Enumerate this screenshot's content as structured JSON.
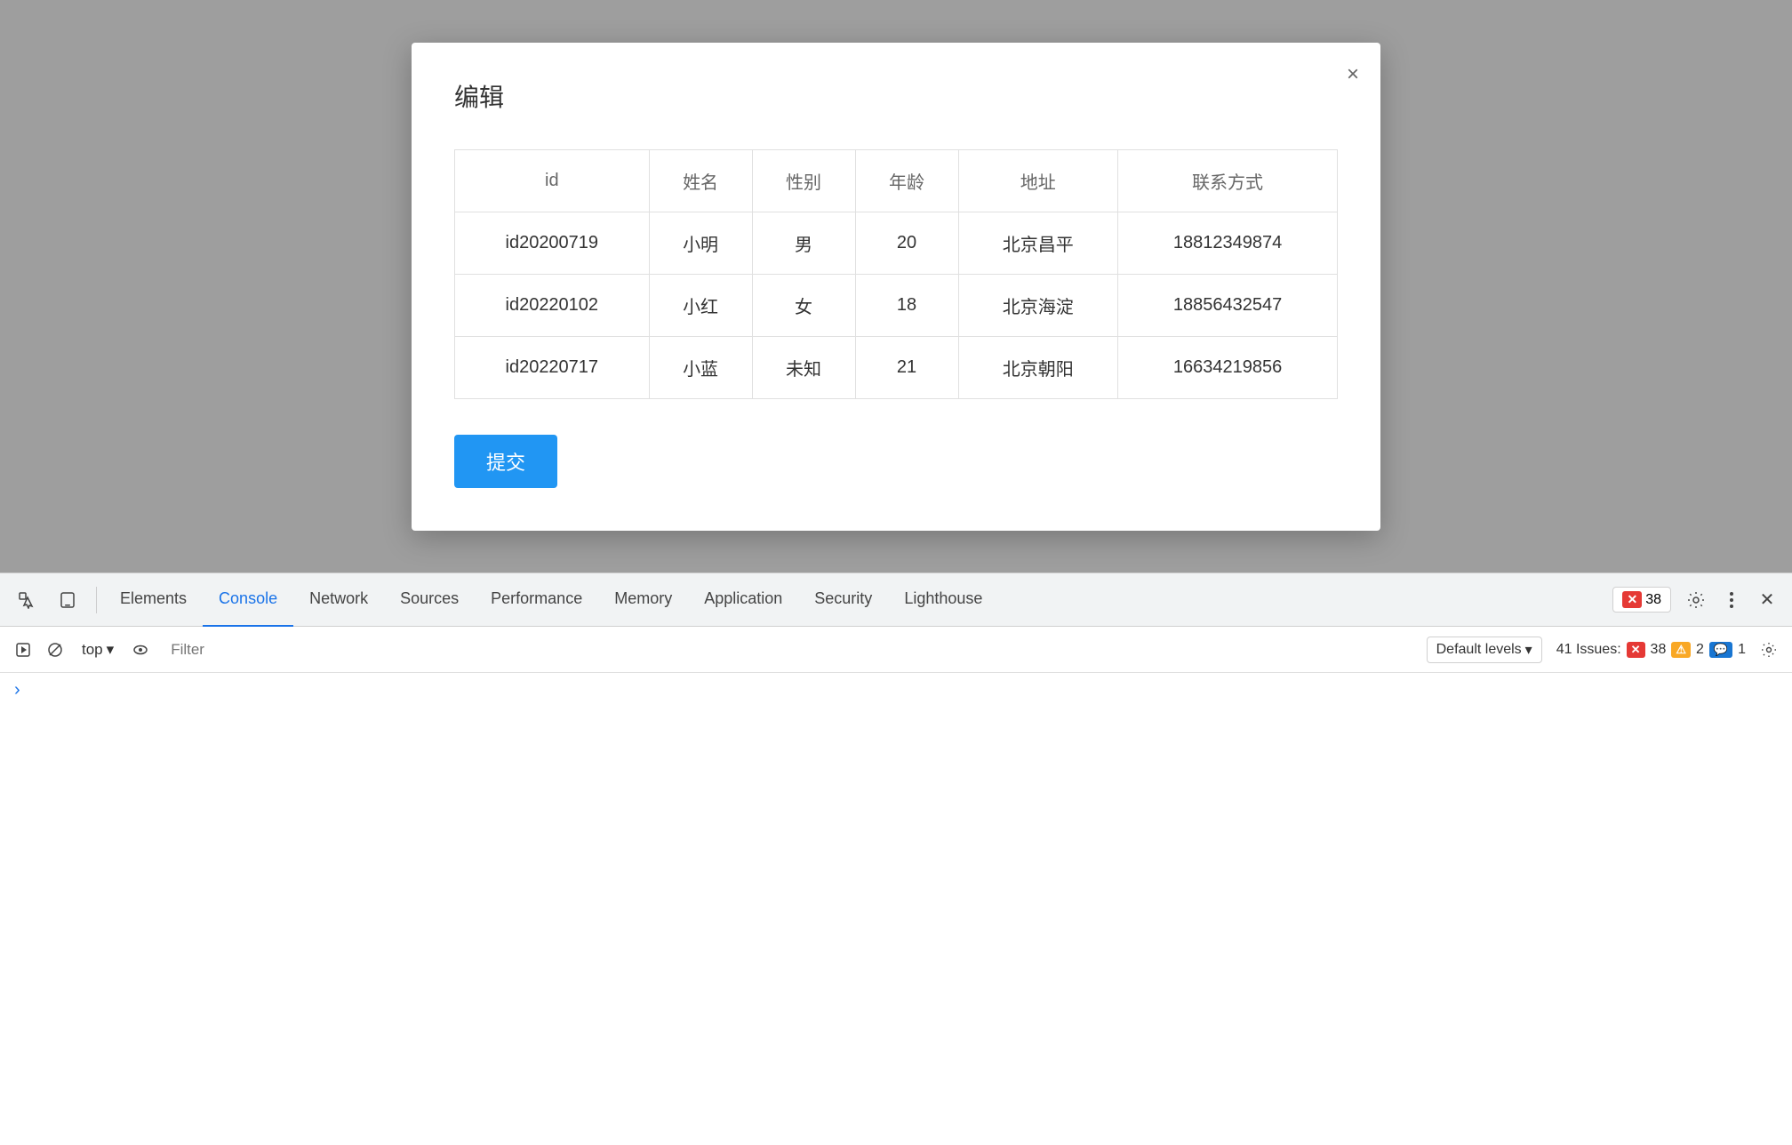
{
  "modal": {
    "title": "编辑",
    "close_label": "×",
    "submit_label": "提交",
    "table": {
      "headers": [
        "id",
        "姓名",
        "性别",
        "年龄",
        "地址",
        "联系方式"
      ],
      "rows": [
        {
          "id": "id20200719",
          "name": "小明",
          "gender": "男",
          "gender_color": "normal",
          "age": "20",
          "age_color": "normal",
          "address": "北京昌平",
          "contact": "18812349874",
          "contact_color": "red"
        },
        {
          "id": "id20220102",
          "name": "小红",
          "gender": "女",
          "gender_color": "red",
          "age": "18",
          "age_color": "normal",
          "address": "北京海淀",
          "contact": "18856432547",
          "contact_color": "normal"
        },
        {
          "id": "id20220717",
          "name": "小蓝",
          "gender": "未知",
          "gender_color": "normal",
          "age": "21",
          "age_color": "red",
          "address": "北京朝阳",
          "contact": "16634219856",
          "contact_color": "normal"
        }
      ]
    }
  },
  "devtools": {
    "tabs": [
      {
        "label": "Elements",
        "active": false
      },
      {
        "label": "Console",
        "active": true
      },
      {
        "label": "Network",
        "active": false
      },
      {
        "label": "Sources",
        "active": false
      },
      {
        "label": "Performance",
        "active": false
      },
      {
        "label": "Memory",
        "active": false
      },
      {
        "label": "Application",
        "active": false
      },
      {
        "label": "Security",
        "active": false
      },
      {
        "label": "Lighthouse",
        "active": false
      }
    ],
    "issues_badge": {
      "count": "38"
    },
    "console_toolbar": {
      "top_label": "top",
      "filter_placeholder": "Filter",
      "default_levels_label": "Default levels",
      "issues_label": "41 Issues:",
      "error_count": "38",
      "warn_count": "2",
      "info_count": "1"
    }
  }
}
